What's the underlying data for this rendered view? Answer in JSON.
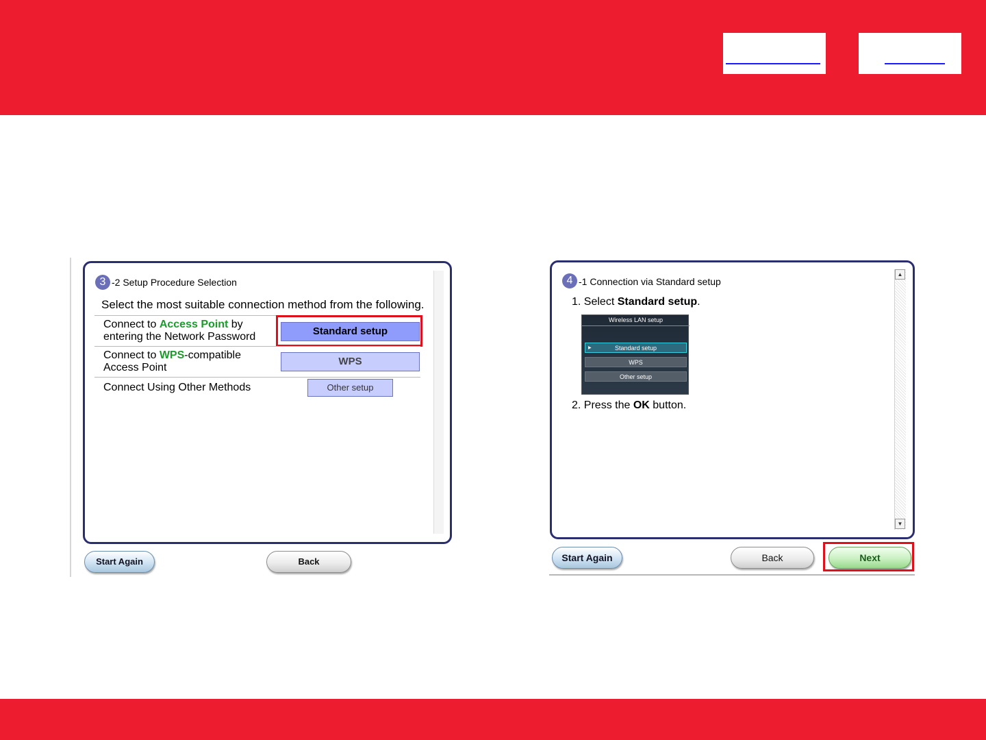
{
  "left_dialog": {
    "step_number": "3",
    "step_title": "-2 Setup Procedure Selection",
    "intro": "Select the most suitable connection method from the following.",
    "options": [
      {
        "prefix": "Connect to ",
        "highlight": "Access Point",
        "suffix": " by",
        "line2": "entering the Network Password",
        "button": "Standard setup"
      },
      {
        "prefix": "Connect to ",
        "highlight": "WPS",
        "suffix": "-compatible",
        "line2": "Access Point",
        "button": "WPS"
      },
      {
        "prefix": "Connect Using Other Methods",
        "button": "Other setup"
      }
    ],
    "start_again": "Start Again",
    "back": "Back"
  },
  "right_dialog": {
    "step_number": "4",
    "step_title": "-1 Connection via Standard setup",
    "instruction1_prefix": "1. Select ",
    "instruction1_bold": "Standard setup",
    "instruction1_suffix": ".",
    "lcd": {
      "title": "Wireless LAN setup",
      "items": [
        "Standard setup",
        "WPS",
        "Other setup"
      ],
      "selected_index": 0
    },
    "instruction2_prefix": "2. Press the ",
    "instruction2_bold": "OK",
    "instruction2_suffix": " button.",
    "start_again": "Start Again",
    "back": "Back",
    "next": "Next"
  },
  "colors": {
    "brand_red": "#ed1c2e",
    "highlight_green": "#1e9a2c",
    "panel_border": "#2b2e6e",
    "selection_frame": "#e0101a"
  }
}
